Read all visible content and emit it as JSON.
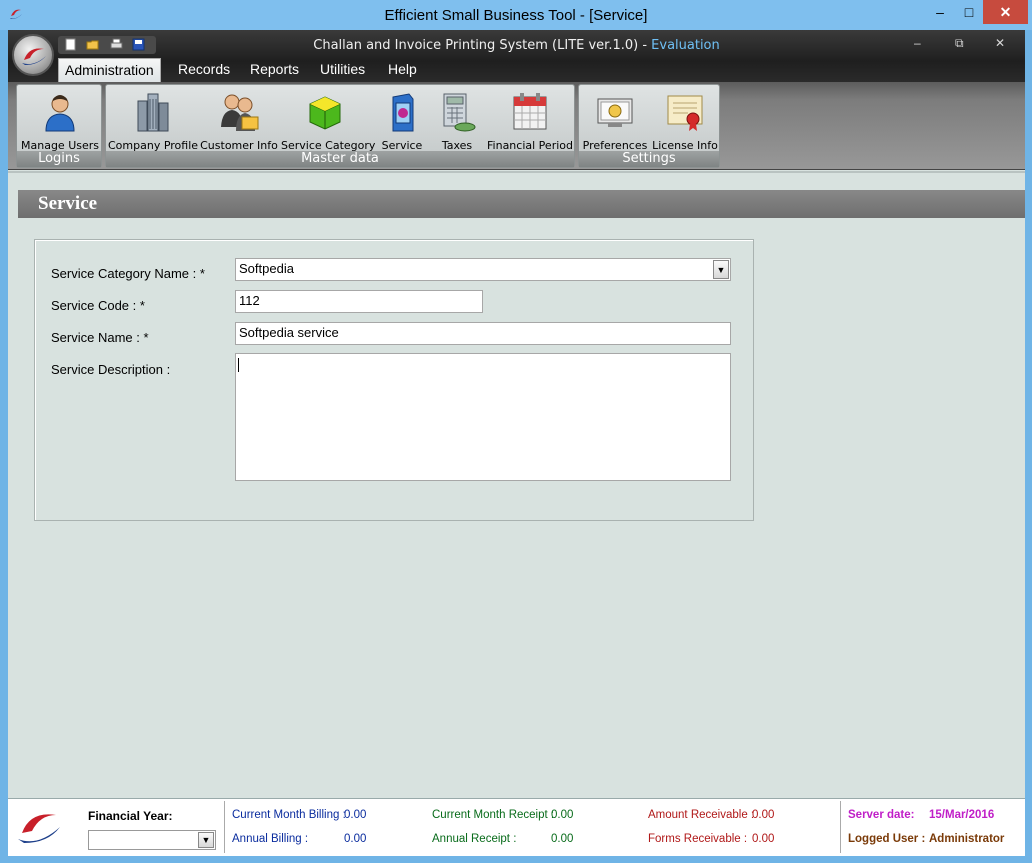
{
  "window": {
    "title": "Efficient Small Business Tool - [Service]",
    "min_glyph": "–",
    "max_glyph": "□",
    "close_glyph": "✕"
  },
  "app": {
    "caption": "Challan and Invoice Printing System (LITE ver.1.0) - ",
    "edition": "Evaluation",
    "min_glyph": "–",
    "restore_glyph": "⧉",
    "close_glyph": "✕"
  },
  "menu": [
    {
      "label": "Administration",
      "active": true
    },
    {
      "label": "Records"
    },
    {
      "label": "Reports"
    },
    {
      "label": "Utilities"
    },
    {
      "label": "Help"
    }
  ],
  "ribbon": {
    "groups": [
      {
        "label": "Logins",
        "buttons": [
          {
            "label": "Manage Users",
            "icon": "user-icon"
          }
        ]
      },
      {
        "label": "Master data",
        "buttons": [
          {
            "label": "Company Profile",
            "icon": "building-icon"
          },
          {
            "label": "Customer Info",
            "icon": "customers-icon"
          },
          {
            "label": "Service Category",
            "icon": "cube-icon"
          },
          {
            "label": "Service",
            "icon": "service-box-icon"
          },
          {
            "label": "Taxes",
            "icon": "calculator-icon"
          },
          {
            "label": "Financial Period",
            "icon": "calendar-icon"
          }
        ]
      },
      {
        "label": "Settings",
        "buttons": [
          {
            "label": "Preferences",
            "icon": "preferences-icon"
          },
          {
            "label": "License Info",
            "icon": "certificate-icon"
          }
        ]
      }
    ]
  },
  "form": {
    "title": "Service",
    "fields": {
      "category": {
        "label": "Service Category Name : *",
        "value": "Softpedia"
      },
      "code": {
        "label": "Service Code : *",
        "value": "112"
      },
      "name": {
        "label": "Service Name : *",
        "value": "Softpedia service"
      },
      "description": {
        "label": "Service Description :",
        "value": ""
      }
    }
  },
  "status": {
    "financial_year_label": "Financial Year:",
    "financial_year_value": "",
    "current_month_billing_label": "Current Month Billing :",
    "current_month_billing_value": "0.00",
    "annual_billing_label": "Annual Billing :",
    "annual_billing_value": "0.00",
    "current_month_receipt_label": "Current Month Receipt :",
    "current_month_receipt_value": "0.00",
    "annual_receipt_label": "Annual Receipt :",
    "annual_receipt_value": "0.00",
    "amount_receivable_label": "Amount Receivable :",
    "amount_receivable_value": "0.00",
    "forms_receivable_label": "Forms Receivable :",
    "forms_receivable_value": "0.00",
    "server_date_label": "Server date:",
    "server_date_value": "15/Mar/2016",
    "logged_user_label": "Logged User :",
    "logged_user_value": "Administrator"
  },
  "colors": {
    "os_titlebar": "#7fbfee",
    "close_button": "#c74b3e",
    "evaluation_text": "#6fc0f5",
    "panel_header": "#7a7a7a",
    "content_bg": "#d8e2df"
  }
}
